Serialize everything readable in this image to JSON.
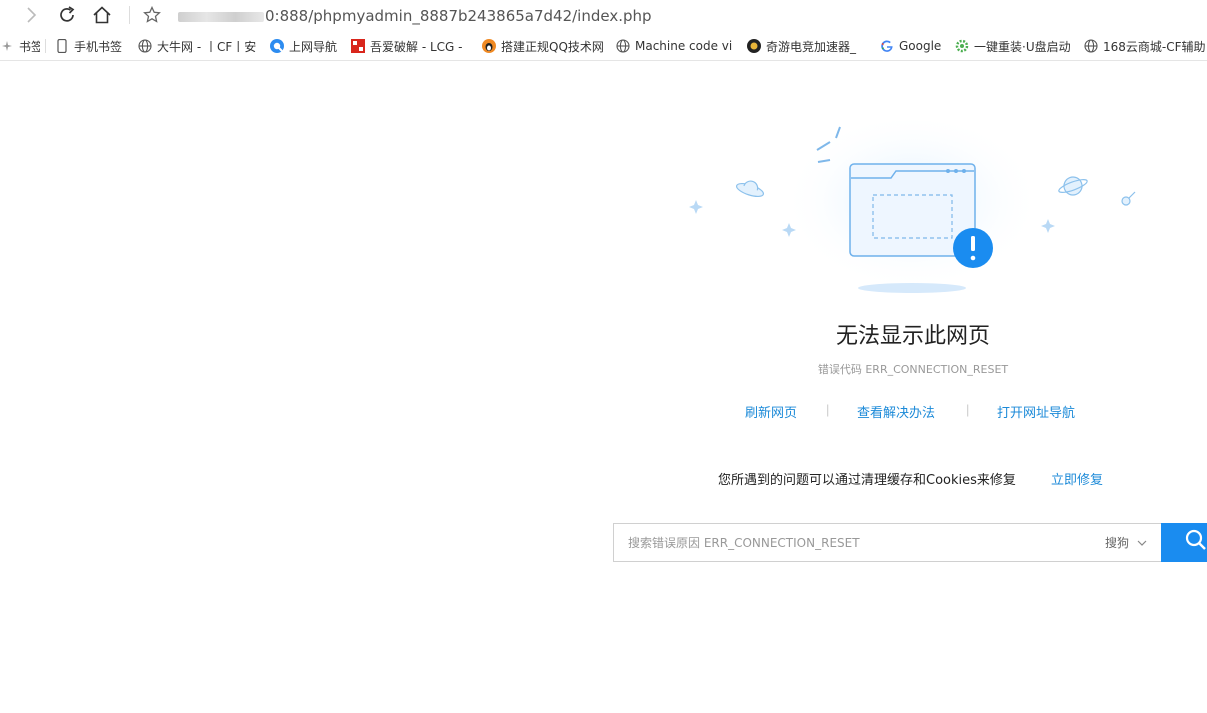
{
  "toolbar": {
    "url_text": "0:888/phpmyadmin_8887b243865a7d42/index.php"
  },
  "bookmarks": [
    {
      "label": "书签",
      "icon": "bookmark-icon"
    },
    {
      "label": "手机书签",
      "icon": "phone-icon"
    },
    {
      "label": "大牛网 - 丨CF丨安",
      "icon": "globe-icon"
    },
    {
      "label": "上网导航",
      "icon": "nav-icon"
    },
    {
      "label": "吾爱破解 - LCG -",
      "icon": "52pojie-icon"
    },
    {
      "label": "搭建正规QQ技术网",
      "icon": "penguin-icon"
    },
    {
      "label": "Machine code vi",
      "icon": "globe-icon"
    },
    {
      "label": "奇游电竞加速器_",
      "icon": "qiyou-icon"
    },
    {
      "label": "Google",
      "icon": "google-icon"
    },
    {
      "label": "一键重装·U盘启动",
      "icon": "gear-green-icon"
    },
    {
      "label": "168云商城-CF辅助",
      "icon": "globe-icon"
    }
  ],
  "error": {
    "title": "无法显示此网页",
    "code": "错误代码 ERR_CONNECTION_RESET"
  },
  "actions": {
    "refresh": "刷新网页",
    "view_solution": "查看解决办法",
    "open_nav": "打开网址导航"
  },
  "fix": {
    "text": "您所遇到的问题可以通过清理缓存和Cookies来修复",
    "link": "立即修复"
  },
  "search": {
    "placeholder": "搜索错误原因 ERR_CONNECTION_RESET",
    "engine": "搜狗"
  },
  "colors": {
    "link": "#1c8ad8",
    "search_button": "#1a8cf0",
    "alert": "#1a8cf0"
  }
}
